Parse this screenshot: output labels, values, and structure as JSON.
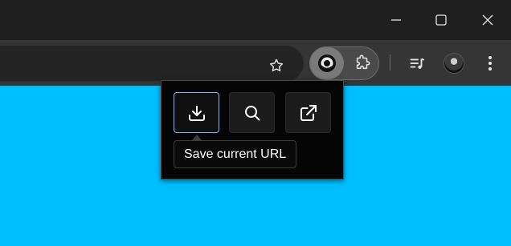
{
  "window": {
    "controls": [
      "minimize-icon",
      "maximize-icon",
      "close-icon"
    ]
  },
  "toolbar": {
    "icons": [
      "star-icon",
      "extension-active-icon",
      "puzzle-icon",
      "media-control-icon",
      "avatar",
      "kebab-menu-icon"
    ]
  },
  "popup": {
    "buttons": [
      {
        "name": "download-button",
        "icon": "download-icon",
        "state": "focused"
      },
      {
        "name": "search-button",
        "icon": "search-icon"
      },
      {
        "name": "open-external-button",
        "icon": "external-link-icon"
      }
    ],
    "tooltip": "Save current URL"
  },
  "colors": {
    "page_background": "#00bfff",
    "titlebar": "#1f1f1f",
    "toolbar": "#353535",
    "popup_background": "#050505",
    "focus_ring": "#8fb5ff"
  }
}
